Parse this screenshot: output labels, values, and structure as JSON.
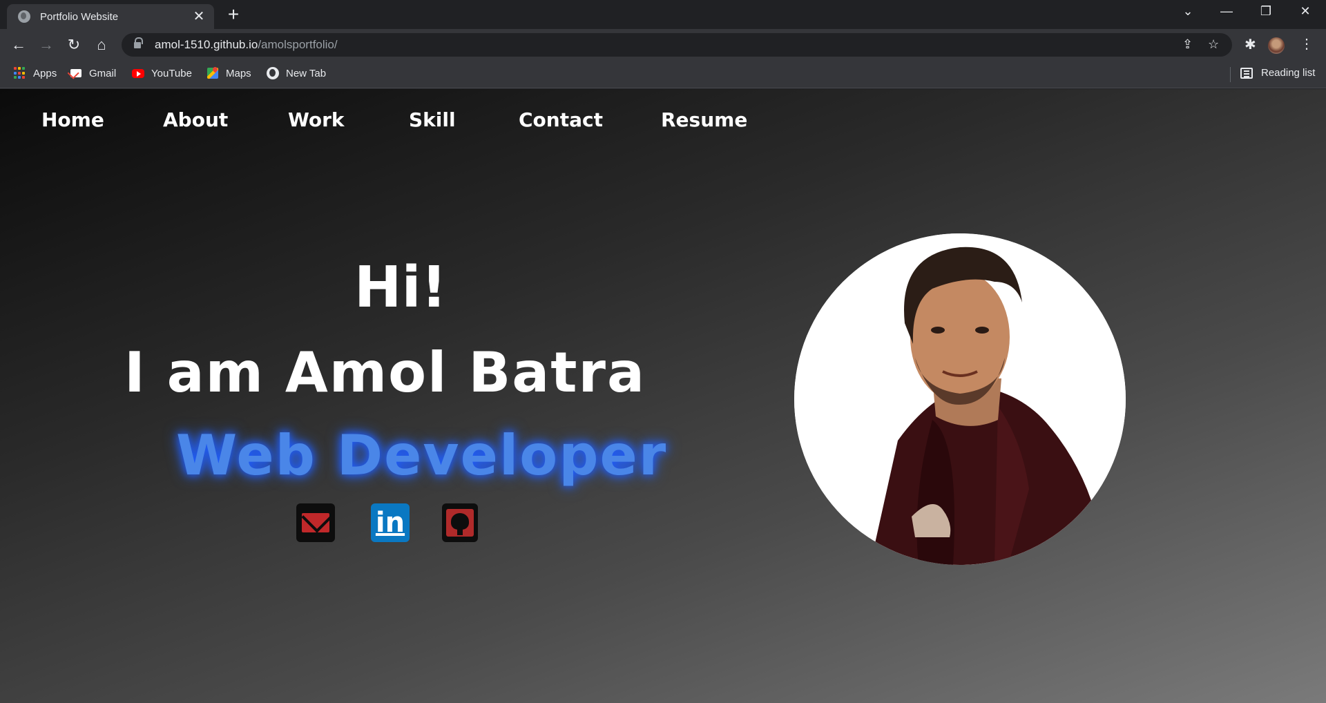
{
  "browser": {
    "tab": {
      "title": "Portfolio Website",
      "close": "✕"
    },
    "new_tab": "+",
    "window_controls": {
      "tabsearch": "⌄",
      "minimize": "—",
      "restore": "❐",
      "close": "✕"
    },
    "toolbar": {
      "back": "←",
      "forward": "→",
      "reload": "↻",
      "home": "⌂",
      "url_host": "amol-1510.github.io",
      "url_path": "/amolsportfolio/",
      "share_icon": "⇪",
      "bookmark_star": "☆",
      "extensions_icon": "✱",
      "menu": "⋮"
    },
    "bookmarks": [
      {
        "label": "Apps",
        "icon": "apps-grid-icon"
      },
      {
        "label": "Gmail",
        "icon": "gmail-icon"
      },
      {
        "label": "YouTube",
        "icon": "youtube-icon"
      },
      {
        "label": "Maps",
        "icon": "maps-icon"
      },
      {
        "label": "New Tab",
        "icon": "globe-icon"
      }
    ],
    "reading_list": "Reading list"
  },
  "site": {
    "nav": [
      "Home",
      "About",
      "Work",
      "Skill",
      "Contact",
      "Resume"
    ],
    "hero": {
      "greeting": "Hi!",
      "name_line": "I am Amol Batra",
      "role": "Web Developer"
    },
    "social": {
      "mail_icon": "envelope-icon",
      "linkedin_label": "in",
      "github_icon": "github-icon"
    },
    "colors": {
      "role_text": "#4a86e8",
      "glow": "#1d5bff",
      "linkedin": "#0a78c2",
      "mail_red": "#c0282a"
    }
  }
}
